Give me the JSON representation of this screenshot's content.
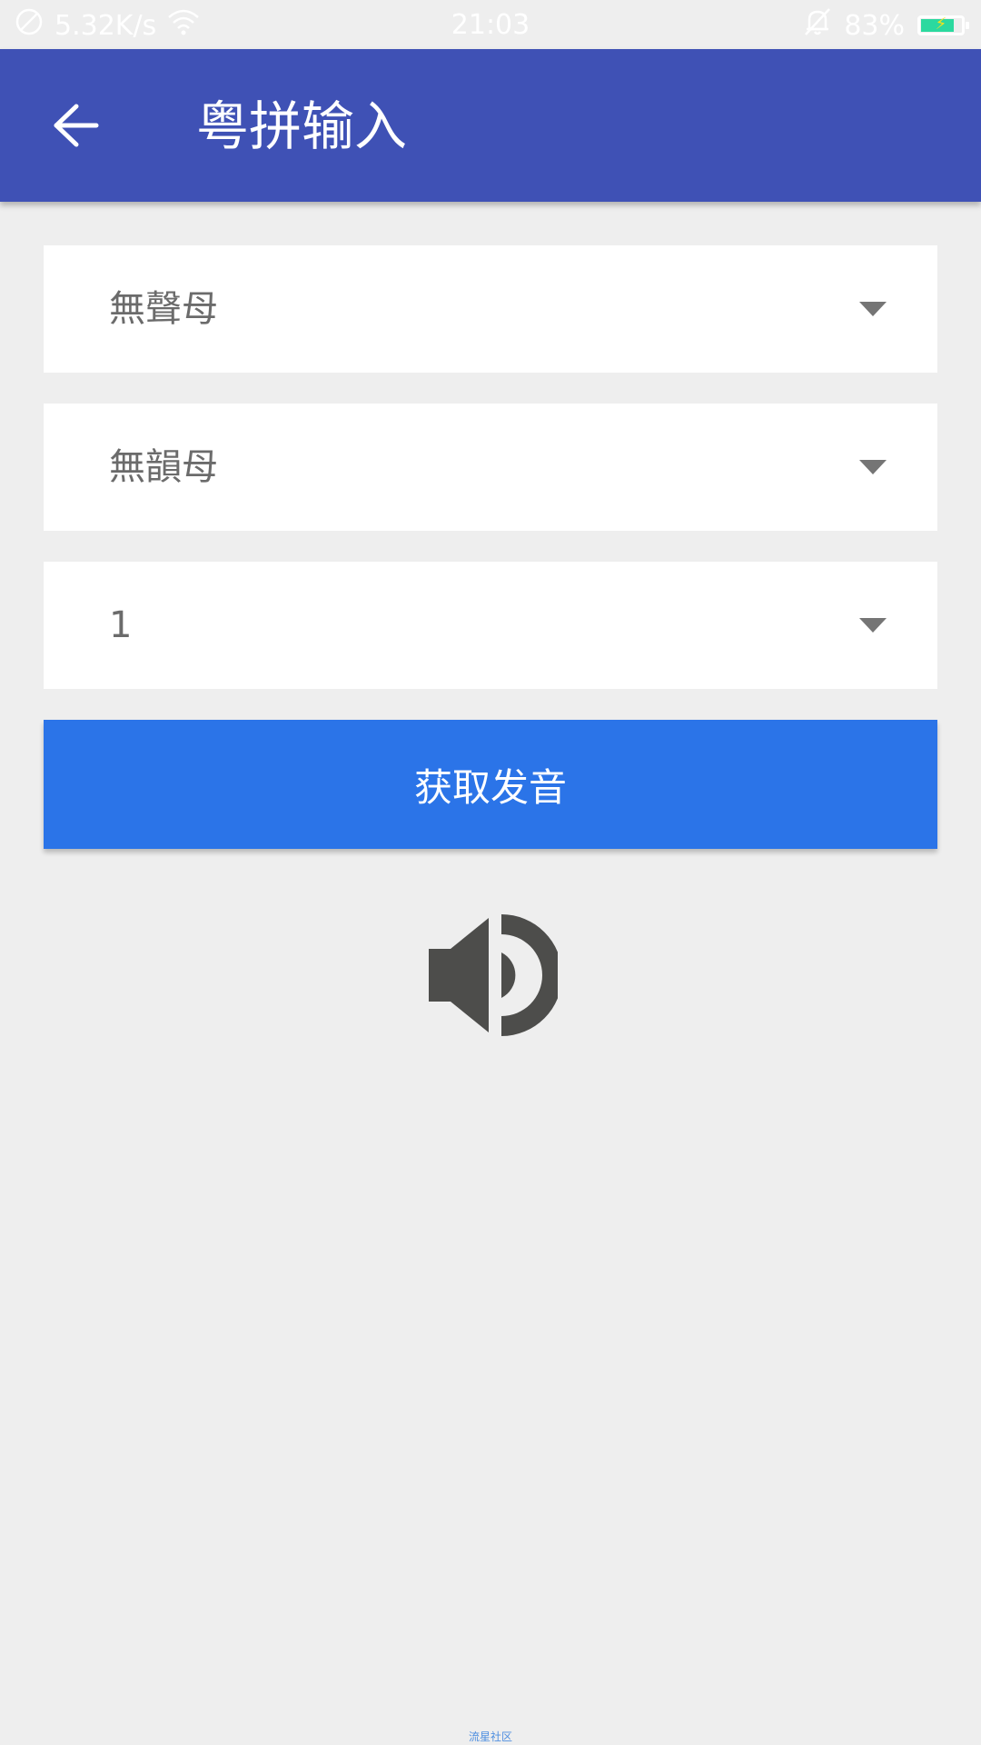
{
  "status_bar": {
    "network_speed": "5.32K/s",
    "time": "21:03",
    "battery_percent": "83%",
    "battery_level": 0.83,
    "icons": [
      "no-sim-icon",
      "wifi-icon",
      "bell-off-icon",
      "battery-icon"
    ]
  },
  "app_bar": {
    "title": "粤拼输入",
    "back_icon": "arrow-left-icon",
    "color": "#3f51b5"
  },
  "selectors": {
    "initial": {
      "selected": "無聲母"
    },
    "final": {
      "selected": "無韻母"
    },
    "tone": {
      "selected": "1"
    }
  },
  "actions": {
    "get_pronunciation_label": "获取发音",
    "button_color": "#2b74e8"
  },
  "speaker": {
    "icon": "speaker-volume-icon"
  },
  "watermark": "流星社区"
}
